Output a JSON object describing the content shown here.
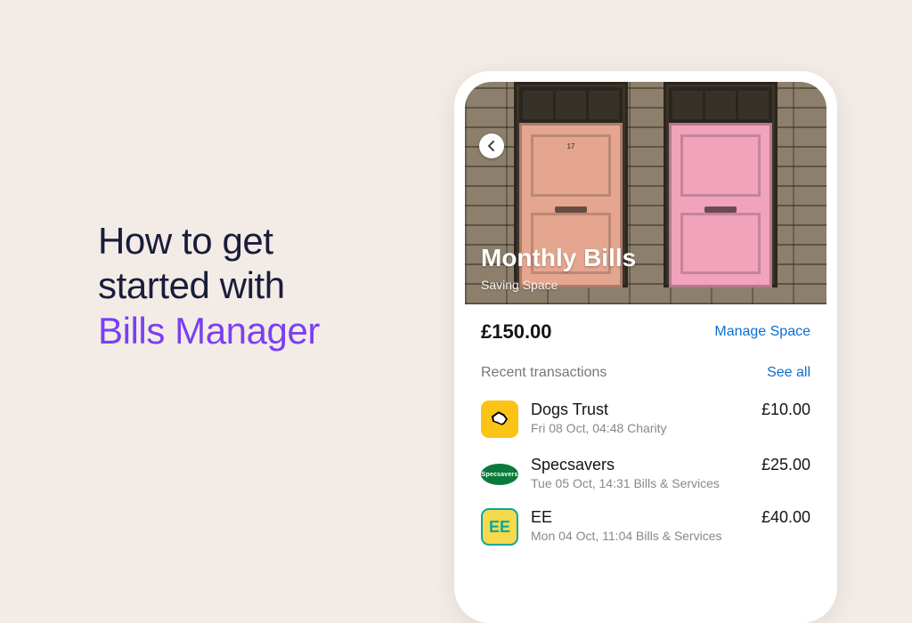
{
  "heading": {
    "line1": "How to get",
    "line2": "started with",
    "accent": "Bills Manager"
  },
  "hero": {
    "title": "Monthly Bills",
    "subtitle": "Saving Space"
  },
  "balance": "£150.00",
  "manage_link": "Manage Space",
  "recent_label": "Recent transactions",
  "see_all": "See all",
  "txns": [
    {
      "name": "Dogs Trust",
      "meta": "Fri 08 Oct, 04:48  Charity",
      "amount": "£10.00",
      "logo": "dogs",
      "logo_text": ""
    },
    {
      "name": "Specsavers",
      "meta": "Tue 05 Oct, 14:31  Bills & Services",
      "amount": "£25.00",
      "logo": "spec",
      "logo_text": "Specsavers"
    },
    {
      "name": "EE",
      "meta": "Mon 04 Oct, 11:04  Bills & Services",
      "amount": "£40.00",
      "logo": "ee",
      "logo_text": "EE"
    }
  ]
}
